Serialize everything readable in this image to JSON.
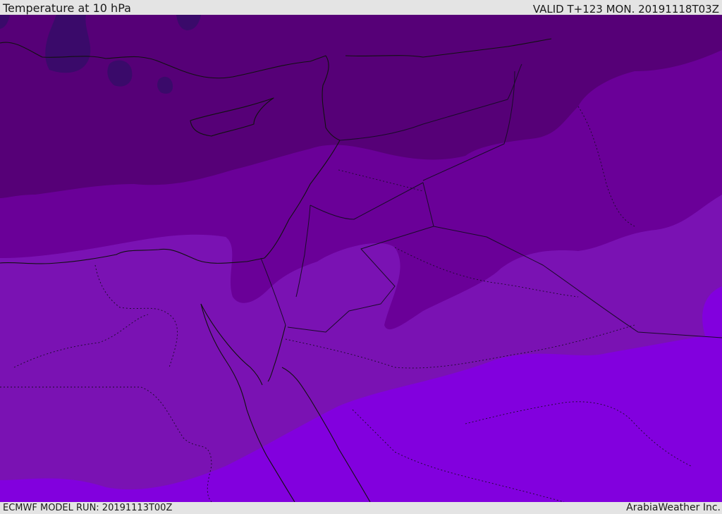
{
  "header": {
    "title": "Temperature at 10 hPa",
    "valid": "VALID T+123 MON. 20191118T03Z"
  },
  "footer": {
    "model_run": "ECMWF MODEL RUN: 20191113T00Z",
    "credit": "ArabiaWeather Inc."
  },
  "map": {
    "field": "Temperature",
    "level": "10 hPa",
    "palette": {
      "darkest": "#3a0a6a",
      "band1": "#560077",
      "band2": "#6a0098",
      "band3": "#7a12b3",
      "band4": "#8200de",
      "coast": "#111111",
      "border": "#1a0a2a"
    }
  }
}
